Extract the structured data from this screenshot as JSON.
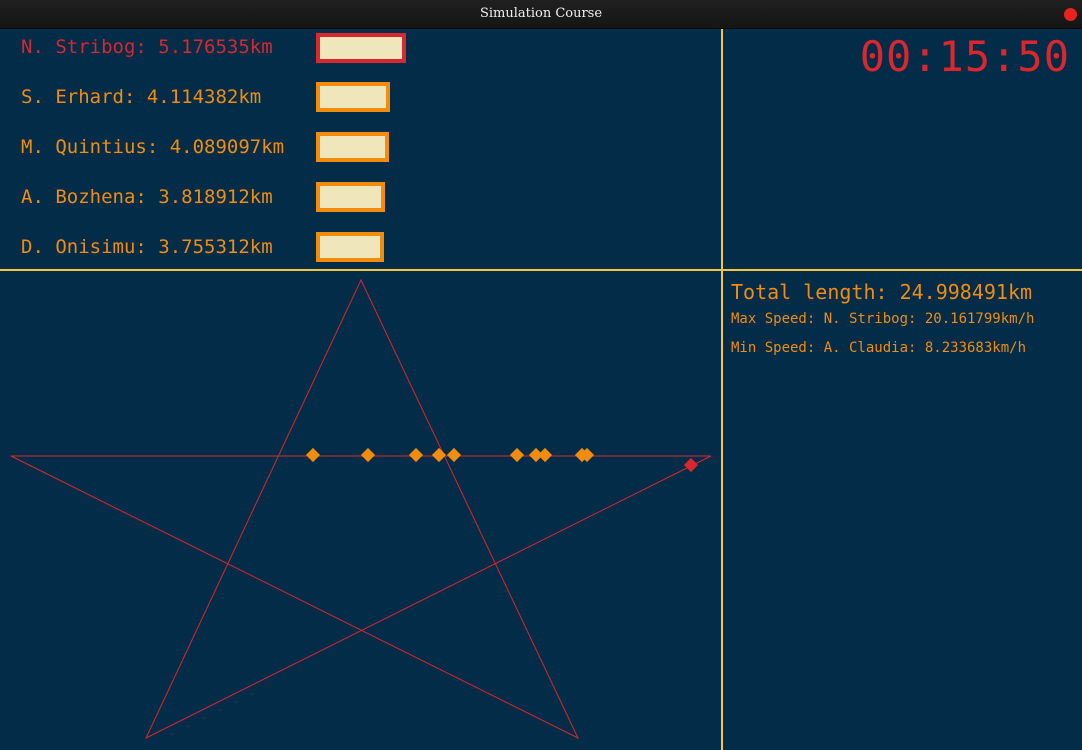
{
  "window": {
    "title": "Simulation Course"
  },
  "leaderboard": [
    {
      "name": "N. Stribog",
      "distance": "5.176535km",
      "display": "N. Stribog: 5.176535km",
      "leader": true
    },
    {
      "name": "S. Erhard",
      "distance": "4.114382km",
      "display": "S. Erhard: 4.114382km",
      "leader": false
    },
    {
      "name": "M. Quintius",
      "distance": "4.089097km",
      "display": "M. Quintius: 4.089097km",
      "leader": false
    },
    {
      "name": "A. Bozhena",
      "distance": "3.818912km",
      "display": "A. Bozhena: 3.818912km",
      "leader": false
    },
    {
      "name": "D. Onisimu",
      "distance": "3.755312km",
      "display": "D. Onisimu: 3.755312km",
      "leader": false
    }
  ],
  "timer": "00:15:50",
  "stats": {
    "total_length": "Total length: 24.998491km",
    "max_speed": "Max Speed: N. Stribog: 20.161799km/h",
    "min_speed": "Min Speed: A. Claudia: 8.233683km/h"
  },
  "colors": {
    "background": "#022c47",
    "accent_orange": "#f28c0f",
    "accent_red": "#d8272e",
    "divider": "#f6c445",
    "bar_fill": "#efe6bb"
  },
  "track": {
    "shape": "pentagram",
    "runner_count": 11
  }
}
